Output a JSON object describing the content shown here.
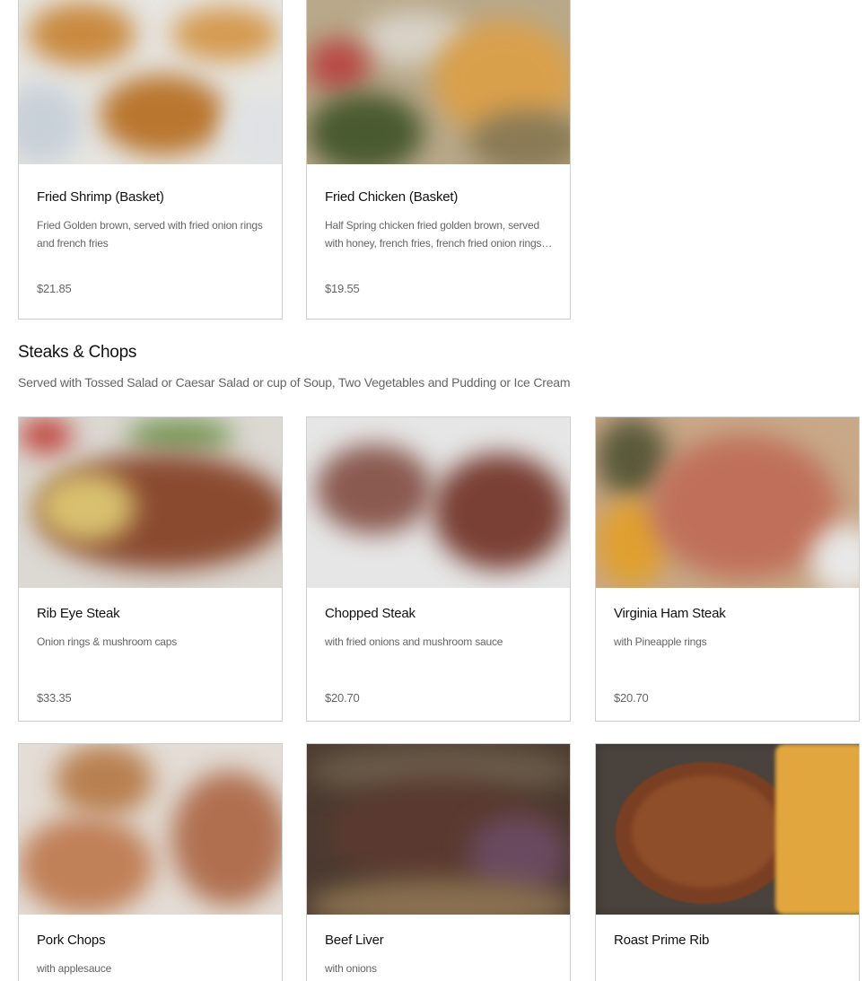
{
  "top_items": [
    {
      "name": "Fried Shrimp (Basket)",
      "description": "Fried Golden brown, served with fried onion rings and french fries",
      "price": "$21.85",
      "image_icon": "fried-shrimp-photo"
    },
    {
      "name": "Fried Chicken (Basket)",
      "description": "Half Spring chicken fried golden brown, served with honey, french fries, french fried onion rings and…",
      "price": "$19.55",
      "image_icon": "fried-chicken-photo"
    }
  ],
  "section": {
    "title": "Steaks & Chops",
    "description": "Served with Tossed Salad or Caesar Salad or cup of Soup, Two Vegetables and Pudding or Ice Cream",
    "items": [
      {
        "name": "Rib Eye Steak",
        "description": "Onion rings & mushroom caps",
        "price": "$33.35",
        "image_icon": "rib-eye-steak-photo"
      },
      {
        "name": "Chopped Steak",
        "description": "with fried onions and mushroom sauce",
        "price": "$20.70",
        "image_icon": "chopped-steak-photo"
      },
      {
        "name": "Virginia Ham Steak",
        "description": "with Pineapple rings",
        "price": "$20.70",
        "image_icon": "ham-steak-photo"
      },
      {
        "name": "Pork Chops",
        "description": "with applesauce",
        "price": "",
        "image_icon": "pork-chops-photo"
      },
      {
        "name": "Beef Liver",
        "description": "with onions",
        "price": "",
        "image_icon": "beef-liver-photo"
      },
      {
        "name": "Roast Prime Rib",
        "description": "",
        "price": "",
        "image_icon": "prime-rib-photo"
      }
    ]
  }
}
